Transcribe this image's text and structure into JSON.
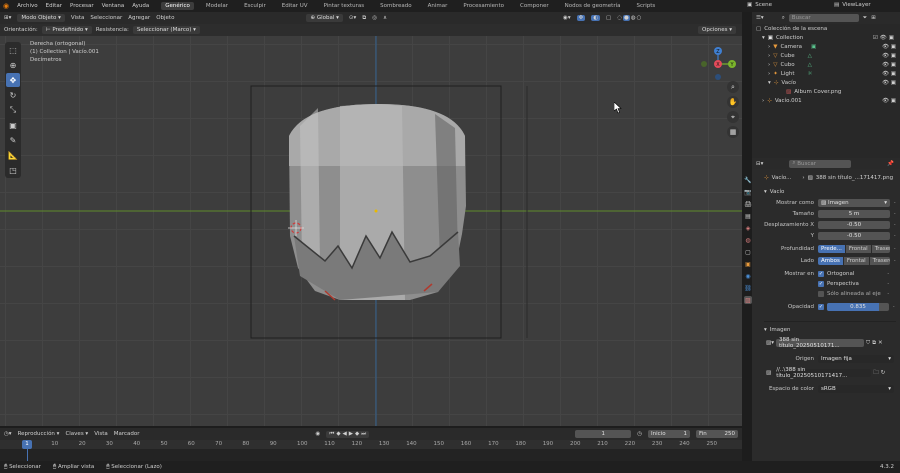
{
  "menubar": {
    "items": [
      "Archivo",
      "Editar",
      "Procesar",
      "Ventana",
      "Ayuda"
    ],
    "workspaces": [
      "Genérico",
      "Modelar",
      "Esculpir",
      "Editar UV",
      "Pintar texturas",
      "Sombreado",
      "Animar",
      "Procesamiento",
      "Componer",
      "Nodos de geometría",
      "Scripts"
    ],
    "active_workspace": "Genérico",
    "scene": "Scene",
    "view_layer": "ViewLayer"
  },
  "viewport_header": {
    "mode": "Modo Objeto",
    "menus": [
      "Vista",
      "Seleccionar",
      "Agregar",
      "Objeto"
    ],
    "transform": "Global",
    "options": "Opciones"
  },
  "tool_header": {
    "orientation_label": "Orientación:",
    "orientation_value": "Predefinido",
    "drag_label": "Resistencia:",
    "drag_value": "Seleccionar (Marco)"
  },
  "overlay_text": {
    "view": "Derecha (ortogonal)",
    "collection": "(1) Collection | Vacío.001",
    "units": "Decímetros"
  },
  "gizmo": {
    "x": "X",
    "y": "Y",
    "z": "Z"
  },
  "outliner": {
    "search_placeholder": "Buscar",
    "title": "Colección de la escena",
    "items": [
      {
        "label": "Collection",
        "indent": 1
      },
      {
        "label": "Camera",
        "indent": 2
      },
      {
        "label": "Cube",
        "indent": 2
      },
      {
        "label": "Cubo",
        "indent": 2
      },
      {
        "label": "Light",
        "indent": 2
      },
      {
        "label": "Vacío",
        "indent": 2
      },
      {
        "label": "Album Cover.png",
        "indent": 3
      },
      {
        "label": "Vacío.001",
        "indent": 1
      }
    ]
  },
  "properties": {
    "search_placeholder": "Buscar",
    "object_name": "Vacío...",
    "image_datablock": "388 sin título_...171417.png",
    "section_empty": "Vacío",
    "display_as_label": "Mostrar como",
    "display_as_value": "Imagen",
    "size_label": "Tamaño",
    "size_value": "5 m",
    "offset_x_label": "Desplazamiento X",
    "offset_x_value": "-0.50",
    "offset_y_label": "Y",
    "offset_y_value": "-0.50",
    "depth_label": "Profundidad",
    "depth_options": [
      "Prede...",
      "Frontal",
      "Trasera"
    ],
    "side_label": "Lado",
    "side_options": [
      "Ambos",
      "Frontal",
      "Trasero"
    ],
    "show_in_label": "Mostrar en",
    "show_orthographic": "Ortogonal",
    "show_perspective": "Perspectiva",
    "show_aligned": "Sólo alineada al eje",
    "opacity_label": "Opacidad",
    "opacity_value": "0.835",
    "opacity_fraction": 0.835,
    "section_image": "Imagen",
    "image_name": "388 sin título_20250510171...",
    "source_label": "Origen",
    "source_value": "Imagen fija",
    "filepath": "//..\\388 sin título_20250510171417...",
    "colorspace_label": "Espacio de color",
    "colorspace_value": "sRGB"
  },
  "timeline": {
    "menus": [
      "Reproducción",
      "Claves",
      "Vista",
      "Marcador"
    ],
    "current_frame": "1",
    "start_label": "Inicio",
    "start_value": "1",
    "end_label": "Fin",
    "end_value": "250",
    "ruler": [
      "1",
      "10",
      "20",
      "30",
      "40",
      "50",
      "60",
      "70",
      "80",
      "90",
      "100",
      "110",
      "120",
      "130",
      "140",
      "150",
      "160",
      "170",
      "180",
      "190",
      "200",
      "210",
      "220",
      "230",
      "240",
      "250"
    ]
  },
  "statusbar": {
    "items": [
      "Seleccionar",
      "Ampliar vista",
      "Seleccionar (Lazo)"
    ],
    "version": "4.3.2"
  },
  "colors": {
    "accent": "#4772b3",
    "viewport_bg": "#3d3d3d",
    "x_axis": "#e44a5a",
    "y_axis": "#7bb52c",
    "z_axis": "#3f7fd1"
  }
}
